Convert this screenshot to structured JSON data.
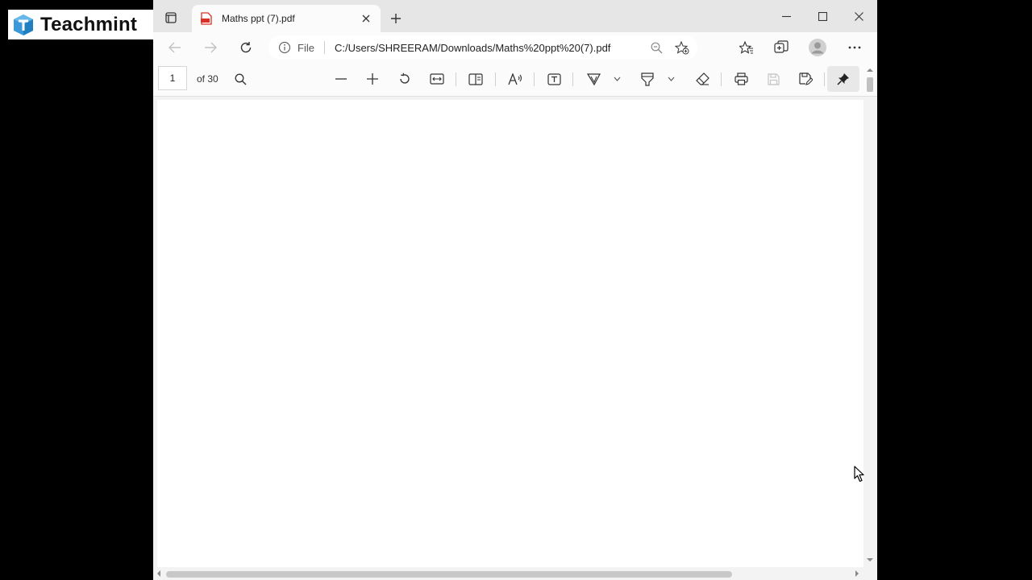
{
  "brand": {
    "name": "Teachmint"
  },
  "browser": {
    "tab": {
      "title": "Maths ppt (7).pdf"
    },
    "address": {
      "scheme_label": "File",
      "url": "C:/Users/SHREERAM/Downloads/Maths%20ppt%20(7).pdf"
    }
  },
  "pdf_viewer": {
    "current_page": "1",
    "page_count": "of 30"
  },
  "icons": {
    "tab_actions": "tab-actions-icon",
    "pdf": "pdf-file-icon",
    "close": "close-icon",
    "new_tab": "plus-icon",
    "minimize": "minimize-icon",
    "maximize": "maximize-icon",
    "back": "arrow-left-icon",
    "forward": "arrow-right-icon",
    "refresh": "refresh-icon",
    "info": "info-icon",
    "zoom": "zoom-out-icon",
    "add_favorite": "star-plus-icon",
    "favorites": "favorites-icon",
    "collections": "collections-icon",
    "profile": "avatar",
    "more": "more-icon",
    "search": "search-icon",
    "rotate": "rotate-icon",
    "fit": "fit-width-icon",
    "page_view": "page-view-icon",
    "read_aloud": "read-aloud-icon",
    "text": "add-text-icon",
    "draw": "draw-icon",
    "highlight": "highlight-icon",
    "erase": "eraser-icon",
    "print": "print-icon",
    "save": "save-icon",
    "save_as": "save-as-icon",
    "pin": "pin-icon"
  },
  "colors": {
    "pdf_badge": "#d93025",
    "logo_blue": "#3a9ad9",
    "toolbar_bg": "#fbfbfb"
  }
}
